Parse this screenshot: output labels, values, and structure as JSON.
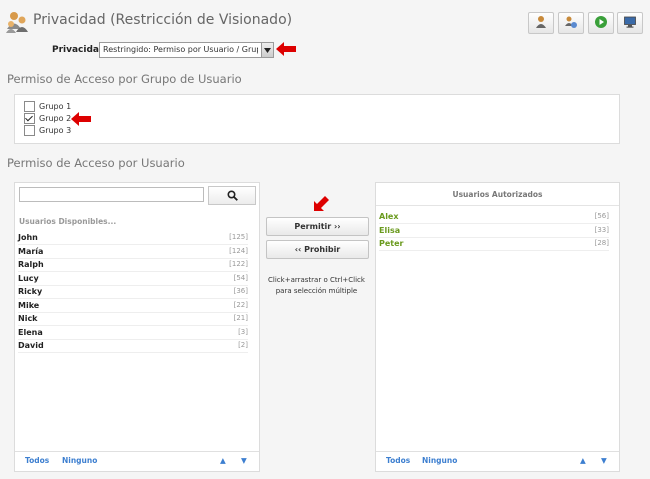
{
  "header": {
    "title": "Privacidad (Restricción de Visionado)",
    "toolbar_icons": [
      "user-admin-icon",
      "user-settings-icon",
      "play-icon",
      "monitor-icon"
    ]
  },
  "privacy": {
    "label": "Privacidad:",
    "selected": "Restringido: Permiso por Usuario / Grupo"
  },
  "groups": {
    "title": "Permiso de Acceso por Grupo de Usuario",
    "items": [
      {
        "label": "Grupo 1",
        "checked": false
      },
      {
        "label": "Grupo 2",
        "checked": true
      },
      {
        "label": "Grupo 3",
        "checked": false
      }
    ]
  },
  "users": {
    "title": "Permiso de Acceso por Usuario",
    "search": {
      "value": "",
      "placeholder": ""
    },
    "available": {
      "heading": "Usuarios Disponibles...",
      "items": [
        {
          "name": "John",
          "count": "[125]"
        },
        {
          "name": "María",
          "count": "[124]"
        },
        {
          "name": "Ralph",
          "count": "[122]"
        },
        {
          "name": "Lucy",
          "count": "[54]"
        },
        {
          "name": "Ricky",
          "count": "[36]"
        },
        {
          "name": "Mike",
          "count": "[22]"
        },
        {
          "name": "Nick",
          "count": "[21]"
        },
        {
          "name": "Elena",
          "count": "[3]"
        },
        {
          "name": "David",
          "count": "[2]"
        }
      ],
      "footer": {
        "all": "Todos",
        "none": "Ninguno",
        "up": "▲",
        "down": "▼"
      }
    },
    "authorized": {
      "heading": "Usuarios Autorizados",
      "items": [
        {
          "name": "Alex",
          "count": "[56]"
        },
        {
          "name": "Elisa",
          "count": "[33]"
        },
        {
          "name": "Peter",
          "count": "[28]"
        }
      ],
      "footer": {
        "all": "Todos",
        "none": "Ninguno",
        "up": "▲",
        "down": "▼"
      }
    },
    "allow_button": "Permitir ››",
    "deny_button": "‹‹ Prohibir",
    "hint_line1": "Click+arrastrar o Ctrl+Click",
    "hint_line2": "para selección múltiple"
  },
  "colors": {
    "accent_link": "#3d7fd0",
    "authorized_name": "#6a9a1e",
    "annotation_arrow": "#dd0000"
  }
}
